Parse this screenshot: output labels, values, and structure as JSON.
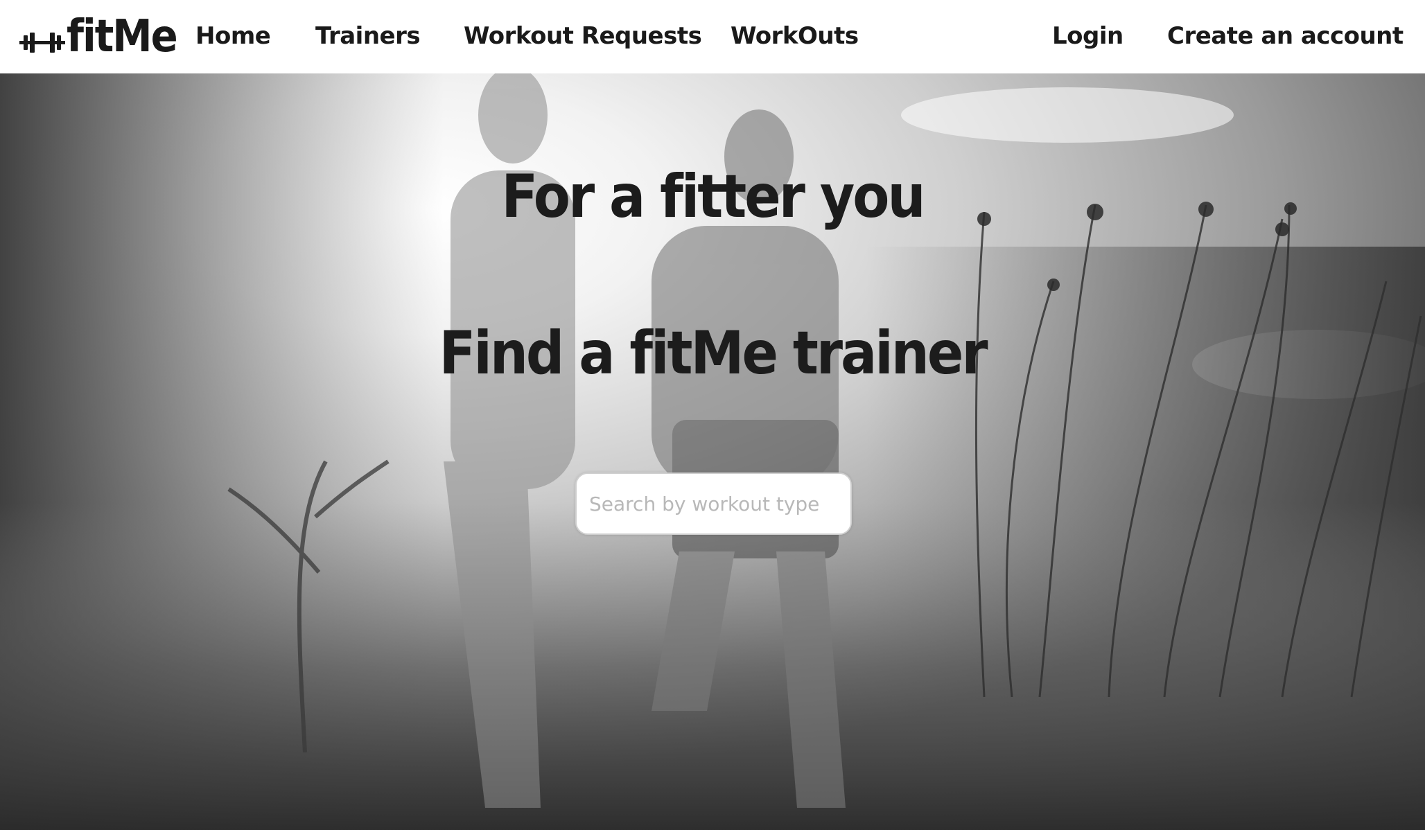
{
  "brand": {
    "name": "fitMe",
    "icon": "dumbbell-icon"
  },
  "nav": {
    "left": [
      {
        "label": "Home"
      },
      {
        "label": "Trainers"
      },
      {
        "label": "Workout Requests"
      },
      {
        "label": "WorkOuts"
      }
    ],
    "right": [
      {
        "label": "Login"
      },
      {
        "label": "Create an account"
      }
    ]
  },
  "hero": {
    "headline_1": "For a fitter you",
    "headline_2": "Find a fitMe trainer",
    "background": "black-and-white-photo-of-two-runners-in-field",
    "search": {
      "placeholder": "Search by workout type",
      "value": ""
    }
  },
  "colors": {
    "text": "#1a1a1a",
    "navbar_bg": "#ffffff",
    "search_border": "#cfcfcf"
  }
}
